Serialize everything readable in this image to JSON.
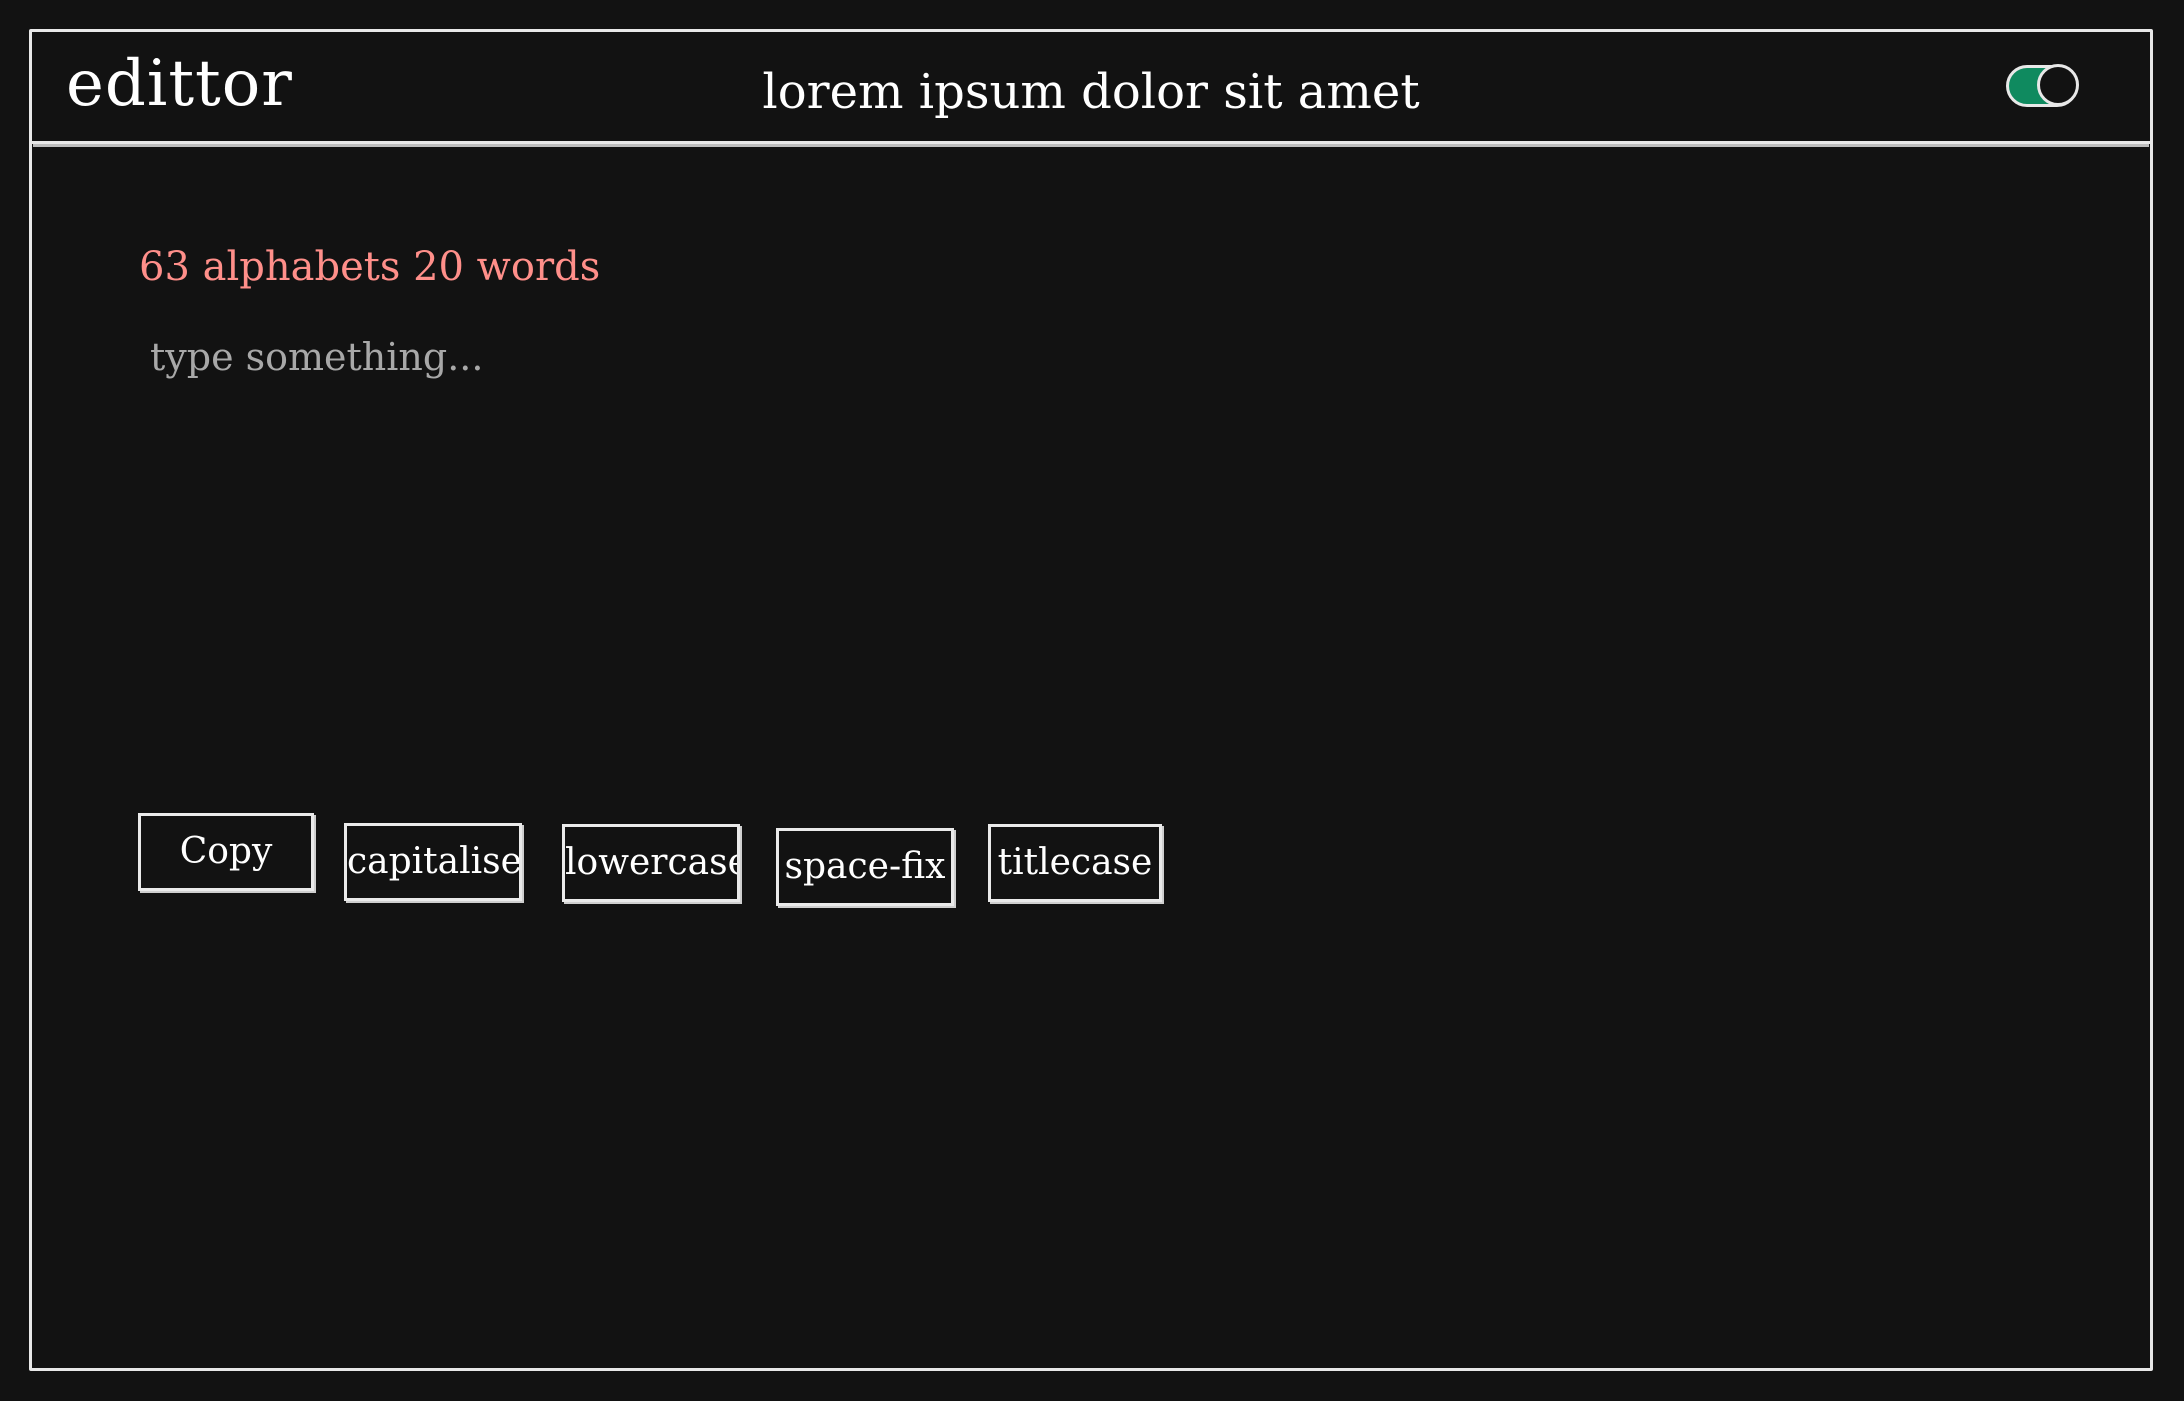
{
  "header": {
    "logo": "edittor",
    "title": "lorem ipsum dolor sit amet"
  },
  "theme_toggle": {
    "state": "on",
    "color": "#0f8a5f"
  },
  "editor": {
    "counter": "63 alphabets 20 words",
    "counter_color": "#ff8f8a",
    "placeholder": "type something..."
  },
  "toolbar": {
    "copy_label": "Copy",
    "capitalise_label": "capitalise",
    "lowercase_label": "lowercase",
    "spacefix_label": "space-fix",
    "titlecase_label": "titlecase"
  }
}
